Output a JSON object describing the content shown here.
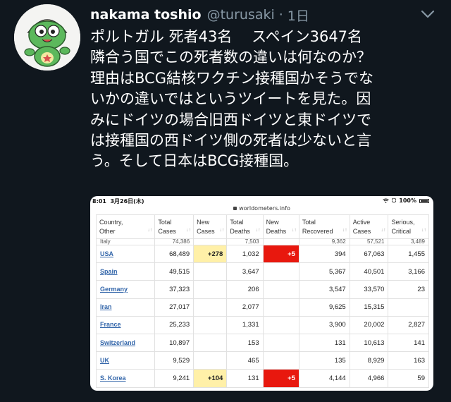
{
  "tweet": {
    "display_name": "nakama toshio",
    "handle": "@turusaki",
    "separator": "·",
    "time": "1日",
    "lines": [
      "ポルトガル 死者43名　 スペイン3647名",
      "隣合う国でこの死者数の違いは何なのか？",
      "理由はBCG結核ワクチン接種国かそうでな",
      "いかの違いではというツイートを見た。因",
      "みにドイツの場合旧西ドイツと東ドイツで",
      "は接種国の西ドイツ側の死者は少ないと言",
      "う。そして日本はBCG接種国。"
    ]
  },
  "screenshot": {
    "status_time": "8:01",
    "status_date": "3月26日(木)",
    "battery": "100%",
    "url": "worldometers.info",
    "headers": [
      "Country,\nOther",
      "Total\nCases",
      "New\nCases",
      "Total\nDeaths",
      "New\nDeaths",
      "Total\nRecovered",
      "Active\nCases",
      "Serious,\nCritical"
    ],
    "partial_row": [
      "Italy",
      "74,386",
      "",
      "7,503",
      "",
      "9,362",
      "57,521",
      "3,489"
    ],
    "rows": [
      {
        "country": "USA",
        "total_cases": "68,489",
        "new_cases": "+278",
        "total_deaths": "1,032",
        "new_deaths": "+5",
        "total_recovered": "394",
        "active_cases": "67,063",
        "serious": "1,455"
      },
      {
        "country": "Spain",
        "total_cases": "49,515",
        "new_cases": "",
        "total_deaths": "3,647",
        "new_deaths": "",
        "total_recovered": "5,367",
        "active_cases": "40,501",
        "serious": "3,166"
      },
      {
        "country": "Germany",
        "total_cases": "37,323",
        "new_cases": "",
        "total_deaths": "206",
        "new_deaths": "",
        "total_recovered": "3,547",
        "active_cases": "33,570",
        "serious": "23"
      },
      {
        "country": "Iran",
        "total_cases": "27,017",
        "new_cases": "",
        "total_deaths": "2,077",
        "new_deaths": "",
        "total_recovered": "9,625",
        "active_cases": "15,315",
        "serious": ""
      },
      {
        "country": "France",
        "total_cases": "25,233",
        "new_cases": "",
        "total_deaths": "1,331",
        "new_deaths": "",
        "total_recovered": "3,900",
        "active_cases": "20,002",
        "serious": "2,827"
      },
      {
        "country": "Switzerland",
        "total_cases": "10,897",
        "new_cases": "",
        "total_deaths": "153",
        "new_deaths": "",
        "total_recovered": "131",
        "active_cases": "10,613",
        "serious": "141"
      },
      {
        "country": "UK",
        "total_cases": "9,529",
        "new_cases": "",
        "total_deaths": "465",
        "new_deaths": "",
        "total_recovered": "135",
        "active_cases": "8,929",
        "serious": "163"
      },
      {
        "country": "S. Korea",
        "total_cases": "9,241",
        "new_cases": "+104",
        "total_deaths": "131",
        "new_deaths": "+5",
        "total_recovered": "4,144",
        "active_cases": "4,966",
        "serious": "59"
      }
    ],
    "colors": {
      "new_cases_highlight": "#fff0a8",
      "new_deaths_highlight": "#e8180e",
      "country_link": "#3366aa"
    }
  },
  "icons": {
    "avatar": "keroro-avatar",
    "menu": "chevron-down-icon"
  }
}
